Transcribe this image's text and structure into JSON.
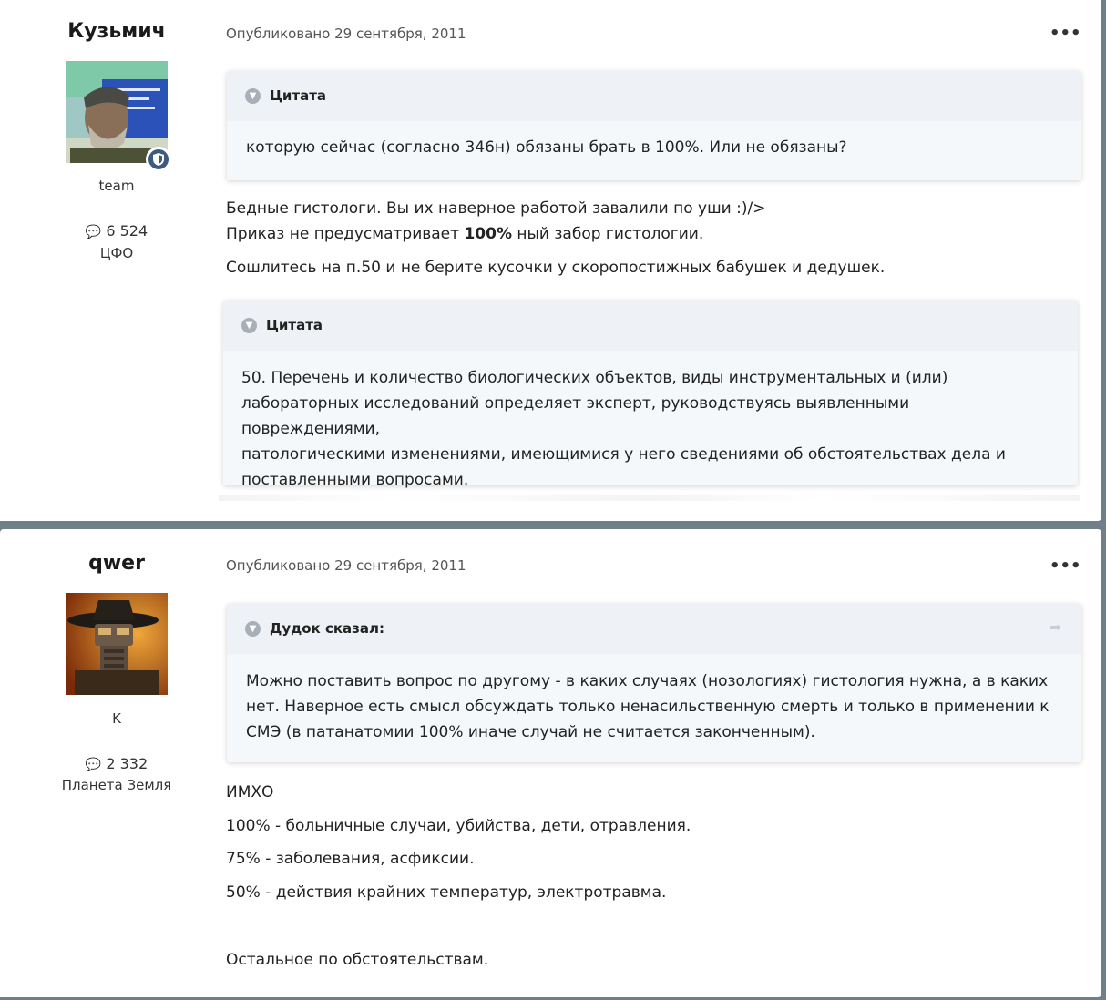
{
  "posts": [
    {
      "author": "Кузьмич",
      "group": "team",
      "posts_count": "6 524",
      "location": "ЦФО",
      "meta": "Опубликовано 29 сентября, 2011",
      "more": "•••",
      "quote1": {
        "title": "Цитата",
        "body": "которую сейчас (согласно 346н) обязаны брать в 100%. Или не обязаны?"
      },
      "line1": "Бедные гистологи. Вы их наверное работой завалили по уши :)/>",
      "line2_pre": "Приказ не предусматривает ",
      "line2_bold": "100%",
      "line2_post": " ный забор гистологии.",
      "line3": "Сошлитесь на п.50 и не берите кусочки у скоропостижных бабушек и дедушек.",
      "quote2": {
        "title": "Цитата",
        "body_lines": [
          "50. Перечень и количество биологических объектов, виды инструментальных и (или)",
          "лабораторных исследований определяет эксперт, руководствуясь выявленными повреждениями,",
          "патологическими изменениями, имеющимися у него сведениями об обстоятельствах дела и",
          "поставленными вопросами."
        ]
      }
    },
    {
      "author": "qwer",
      "group": "K",
      "posts_count": "2 332",
      "location": "Планета Земля",
      "meta": "Опубликовано 29 сентября, 2011",
      "more": "•••",
      "quote1": {
        "title": "Дудок сказал:",
        "body_lines": [
          "Можно поставить вопрос по другому - в каких случаях (нозологиях) гистология нужна, а в каких",
          "нет. Наверное есть смысл обсуждать только ненасильственную смерть и только в применении к",
          "СМЭ (в патанатомии 100% иначе случай не считается законченным)."
        ]
      },
      "lines": [
        "ИМХО",
        "100% - больничные случаи, убийства, дети, отравления.",
        "75% - заболевания, асфиксии.",
        "50% - действия крайних температур, электротравма.",
        "Остальное по обстоятельствам."
      ]
    }
  ],
  "icons": {
    "chevron": "chevron-down-icon",
    "comment": "comment-icon",
    "share": "share-icon",
    "badge": "shield-icon"
  }
}
